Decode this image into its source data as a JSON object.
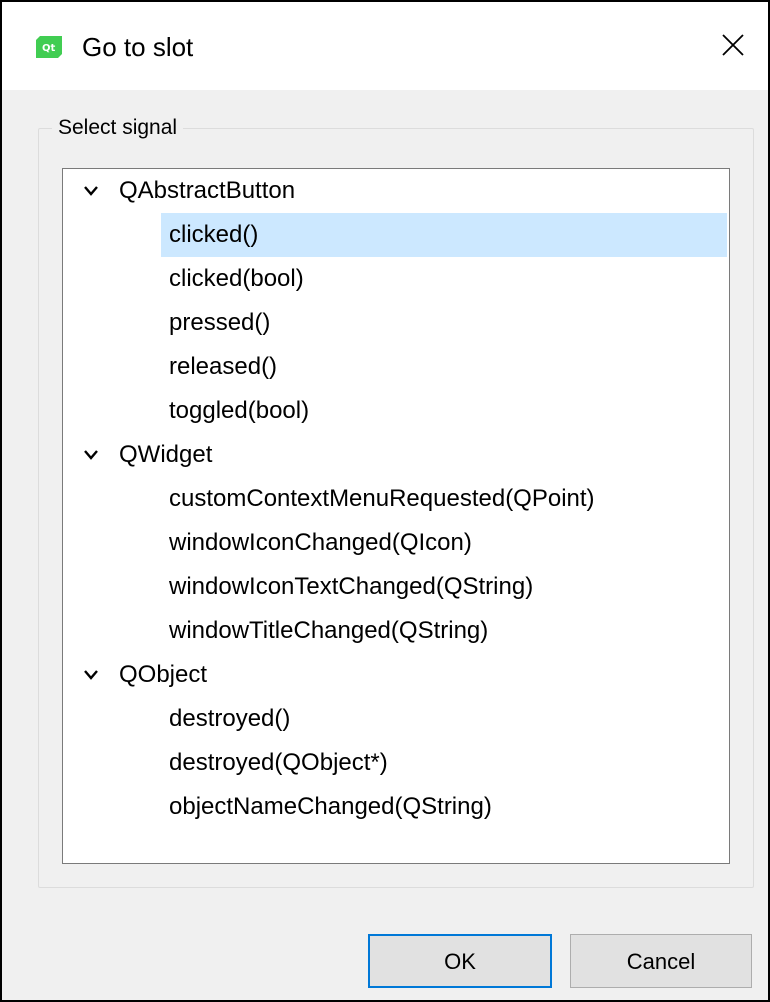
{
  "window": {
    "title": "Go to slot",
    "app_icon": "qt-icon",
    "close_icon": "close-icon"
  },
  "group": {
    "title": "Select signal"
  },
  "tree": {
    "selected": "clicked()",
    "groups": [
      {
        "label": "QAbstractButton",
        "expanded": true,
        "items": [
          "clicked()",
          "clicked(bool)",
          "pressed()",
          "released()",
          "toggled(bool)"
        ]
      },
      {
        "label": "QWidget",
        "expanded": true,
        "items": [
          "customContextMenuRequested(QPoint)",
          "windowIconChanged(QIcon)",
          "windowIconTextChanged(QString)",
          "windowTitleChanged(QString)"
        ]
      },
      {
        "label": "QObject",
        "expanded": true,
        "items": [
          "destroyed()",
          "destroyed(QObject*)",
          "objectNameChanged(QString)"
        ]
      }
    ]
  },
  "buttons": {
    "ok": "OK",
    "cancel": "Cancel"
  },
  "colors": {
    "selection": "#cce8ff",
    "default_button_border": "#0078d7",
    "qt_icon": "#41cd52"
  }
}
